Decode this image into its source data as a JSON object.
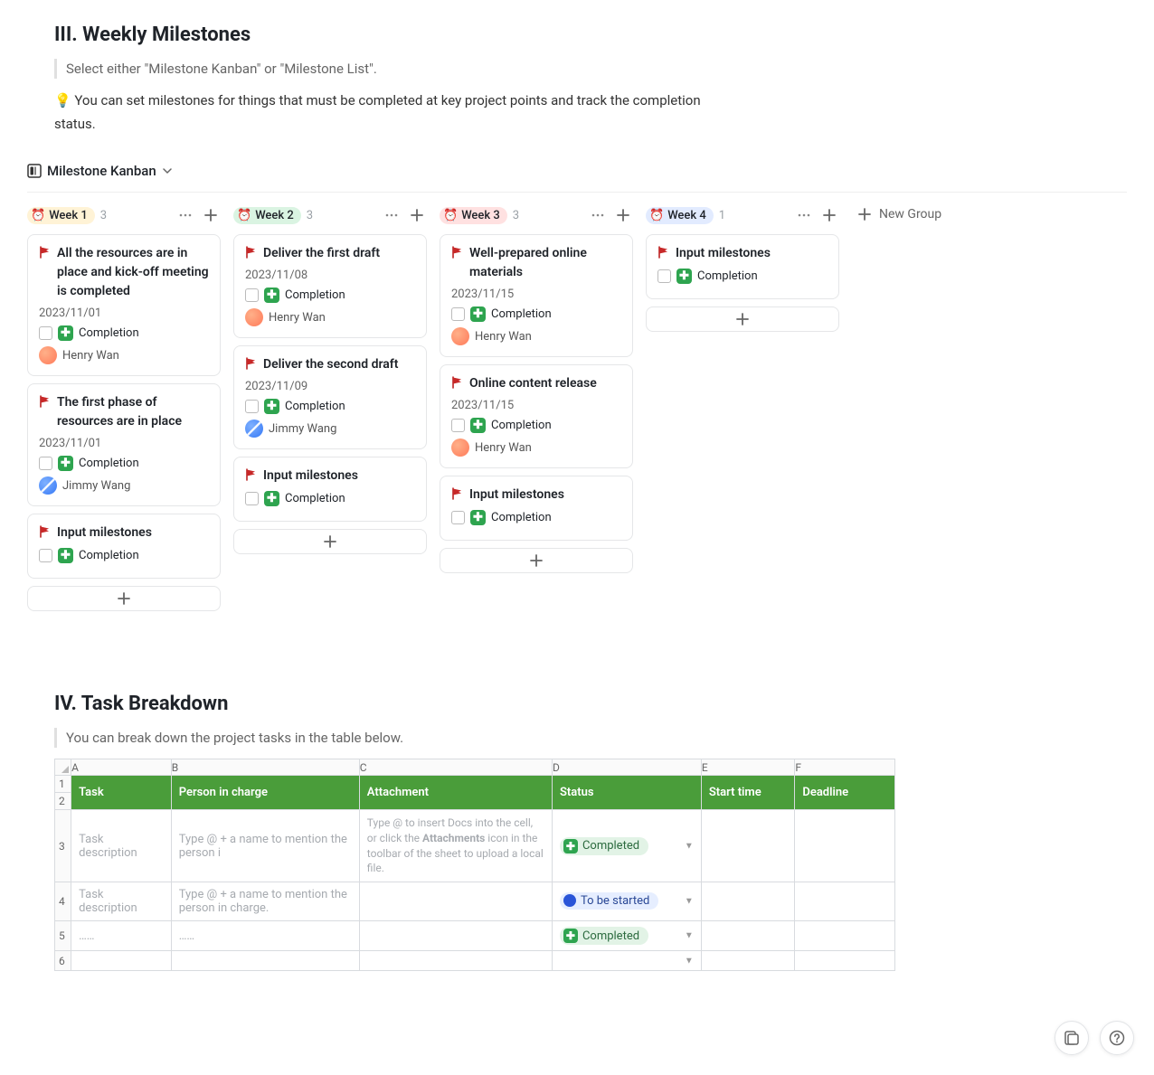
{
  "milestones": {
    "heading": "III. Weekly Milestones",
    "blockquote": "Select either \"Milestone Kanban\" or \"Milestone List\".",
    "tip": "💡 You can set milestones for things that must be completed at key project points and track the completion status.",
    "view_label": "Milestone Kanban",
    "new_group_label": "New Group",
    "completion_label": "Completion",
    "columns": [
      {
        "key": "w1",
        "title": "Week 1",
        "count": "3",
        "cards": [
          {
            "title": "All the resources are in place and kick-off meeting is completed",
            "date": "2023/11/01",
            "completion": true,
            "assignee": {
              "name": "Henry Wan",
              "avatar": "orange"
            }
          },
          {
            "title": "The first phase of resources are in place",
            "date": "2023/11/01",
            "completion": true,
            "assignee": {
              "name": "Jimmy Wang",
              "avatar": "blue"
            }
          },
          {
            "title": "Input milestones",
            "completion": true
          }
        ]
      },
      {
        "key": "w2",
        "title": "Week 2",
        "count": "3",
        "cards": [
          {
            "title": "Deliver the first draft",
            "date": "2023/11/08",
            "completion": true,
            "assignee": {
              "name": "Henry Wan",
              "avatar": "orange"
            }
          },
          {
            "title": "Deliver the second draft",
            "date": "2023/11/09",
            "completion": true,
            "assignee": {
              "name": "Jimmy Wang",
              "avatar": "blue"
            }
          },
          {
            "title": "Input milestones",
            "completion": true
          }
        ]
      },
      {
        "key": "w3",
        "title": "Week 3",
        "count": "3",
        "cards": [
          {
            "title": "Well-prepared online materials",
            "date": "2023/11/15",
            "completion": true,
            "assignee": {
              "name": "Henry Wan",
              "avatar": "orange"
            }
          },
          {
            "title": "Online content release",
            "date": "2023/11/15",
            "completion": true,
            "assignee": {
              "name": "Henry Wan",
              "avatar": "orange"
            }
          },
          {
            "title": "Input milestones",
            "completion": true
          }
        ]
      },
      {
        "key": "w4",
        "title": "Week 4",
        "count": "1",
        "cards": [
          {
            "title": "Input milestones",
            "completion": true
          }
        ]
      }
    ]
  },
  "tasks": {
    "heading": "IV. Task Breakdown",
    "blockquote": "You can break down the project tasks in the table below.",
    "col_letters": [
      "A",
      "B",
      "C",
      "D",
      "E",
      "F"
    ],
    "headers": [
      "Task",
      "Person in charge",
      "Attachment",
      "Status",
      "Start time",
      "Deadline"
    ],
    "attach_hint_pre": "Type @ to insert Docs into the cell, or click the ",
    "attach_hint_bold": "Attachments",
    "attach_hint_post": " icon in the toolbar of the sheet to upload a local file.",
    "task_desc_placeholder": "Task description",
    "person_placeholder_long": "Type @ + a name to mention the person in charge.",
    "person_placeholder_trunc": "Type @ + a name to mention the person i",
    "ellipsis": "……",
    "status_completed": "Completed",
    "status_tobestarted": "To be started",
    "row_nums": [
      "1",
      "2",
      "3",
      "4",
      "5",
      "6"
    ]
  }
}
